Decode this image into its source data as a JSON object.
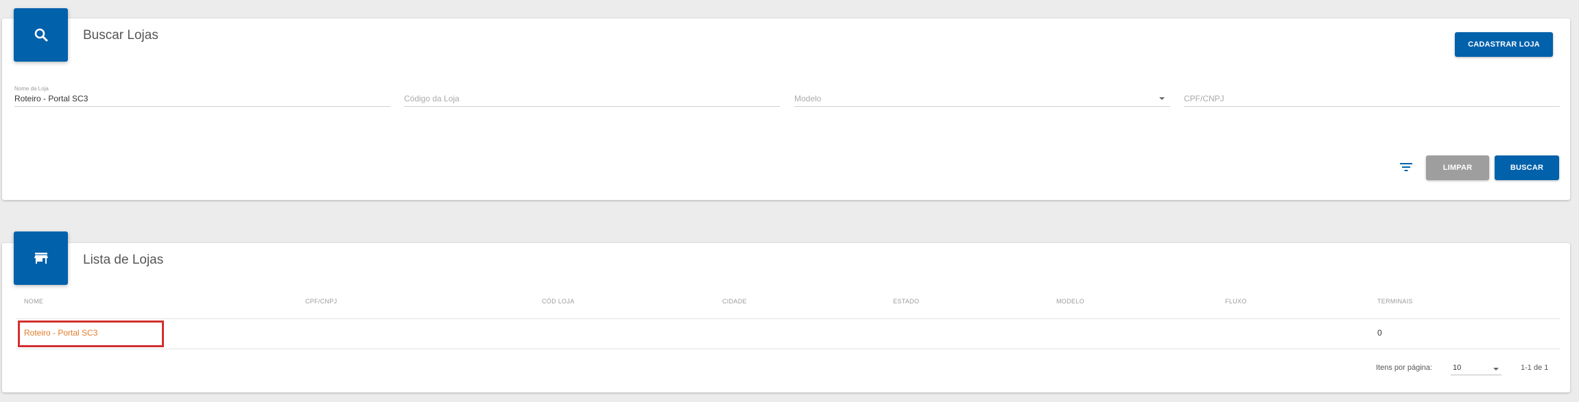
{
  "colors": {
    "primary": "#0161ab",
    "secondary_button": "#9e9e9e",
    "link": "#e07b2a",
    "highlight": "#d32f2f",
    "background": "#ececec"
  },
  "search_card": {
    "icon": "search-icon",
    "title": "Buscar Lojas",
    "register_button": "CADASTRAR LOJA",
    "fields": {
      "store_name": {
        "label": "Nome da Loja",
        "value": "Roteiro - Portal SC3"
      },
      "store_code": {
        "placeholder": "Código da Loja"
      },
      "model": {
        "placeholder": "Modelo"
      },
      "cpf_cnpj": {
        "placeholder": "CPF/CNPJ"
      }
    },
    "filter_icon": "filter-list-icon",
    "clear_button": "LIMPAR",
    "search_button": "BUSCAR"
  },
  "list_card": {
    "icon": "store-icon",
    "title": "Lista de Lojas",
    "columns": [
      "NOME",
      "CPF/CNPJ",
      "CÓD LOJA",
      "CIDADE",
      "ESTADO",
      "MODELO",
      "FLUXO",
      "TERMINAIS"
    ],
    "rows": [
      {
        "nome": "Roteiro - Portal SC3",
        "cpf_cnpj": "",
        "cod_loja": "",
        "cidade": "",
        "estado": "",
        "modelo": "",
        "fluxo": "",
        "terminais": "0"
      }
    ],
    "pagination": {
      "items_per_page_label": "Itens por página:",
      "items_per_page": "10",
      "range": "1-1 de 1"
    }
  }
}
